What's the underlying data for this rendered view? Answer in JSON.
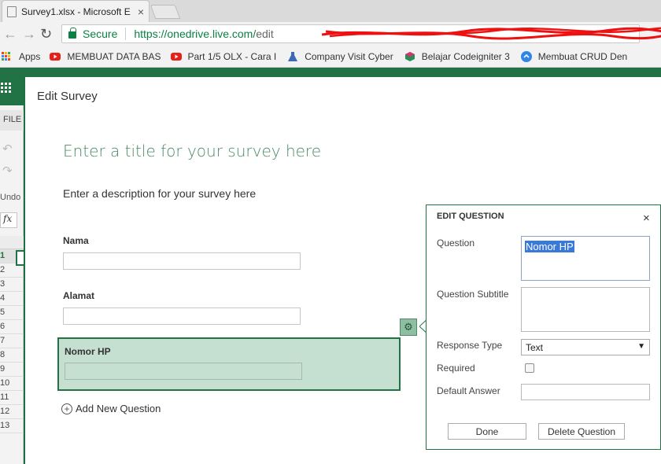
{
  "browser": {
    "tab_title": "Survey1.xlsx - Microsoft E",
    "tab_close": "×",
    "secure_label": "Secure",
    "url_visible": "https://onedrive.live.com/",
    "url_tail": "edit",
    "bookmarks": [
      {
        "label": "Apps",
        "icon": "apps-grid-icon"
      },
      {
        "label": "MEMBUAT DATA BAS",
        "icon": "youtube-icon",
        "color": "#e62117"
      },
      {
        "label": "Part 1/5 OLX - Cara I",
        "icon": "youtube-icon",
        "color": "#e62117"
      },
      {
        "label": "Company Visit Cyber",
        "icon": "flask-icon",
        "color": "#3d6bb3"
      },
      {
        "label": "Belajar Codeigniter 3",
        "icon": "cube-icon",
        "color": "#2e8b57"
      },
      {
        "label": "Membuat CRUD Den",
        "icon": "link-icon",
        "color": "#2f86e8"
      }
    ]
  },
  "excel": {
    "file_tab": "FILE",
    "undo_label": "Undo",
    "fx_label": "fx",
    "rows": [
      "1",
      "2",
      "3",
      "4",
      "5",
      "6",
      "7",
      "8",
      "9",
      "10",
      "11",
      "12",
      "13"
    ]
  },
  "editor": {
    "header": "Edit Survey",
    "title_placeholder": "Enter a title for your survey here",
    "description_placeholder": "Enter a description for your survey here",
    "questions": [
      {
        "label": "Nama"
      },
      {
        "label": "Alamat"
      },
      {
        "label": "Nomor HP"
      }
    ],
    "add_question": "Add New Question"
  },
  "edit_question": {
    "heading": "EDIT QUESTION",
    "close": "×",
    "question_label": "Question",
    "question_value": "Nomor HP",
    "subtitle_label": "Question Subtitle",
    "response_type_label": "Response Type",
    "response_type_value": "Text",
    "required_label": "Required",
    "default_answer_label": "Default Answer",
    "done": "Done",
    "delete": "Delete Question"
  },
  "colors": {
    "excel_green": "#217346",
    "active_question_bg": "#c5dfd1",
    "secure_green": "#0b8043"
  }
}
